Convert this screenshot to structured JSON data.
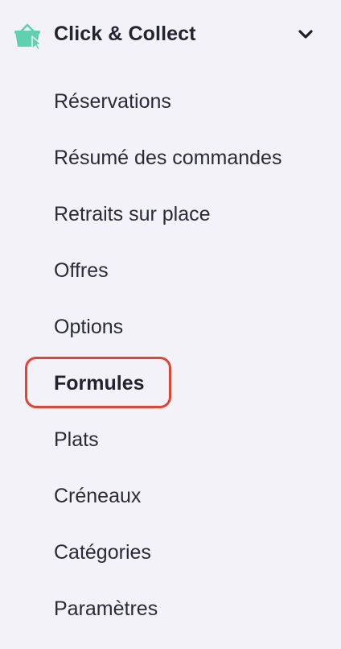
{
  "section": {
    "title": "Click & Collect",
    "icon": "shopping-basket-cursor-icon",
    "icon_color": "#5fd0b0",
    "expand_icon": "chevron-down-icon",
    "expanded": true
  },
  "menu": {
    "items": [
      {
        "label": "Réservations",
        "active": false
      },
      {
        "label": "Résumé des commandes",
        "active": false
      },
      {
        "label": "Retraits sur place",
        "active": false
      },
      {
        "label": "Offres",
        "active": false
      },
      {
        "label": "Options",
        "active": false
      },
      {
        "label": "Formules",
        "active": true
      },
      {
        "label": "Plats",
        "active": false
      },
      {
        "label": "Créneaux",
        "active": false
      },
      {
        "label": "Catégories",
        "active": false
      },
      {
        "label": "Paramètres",
        "active": false
      }
    ]
  },
  "highlight": {
    "target": "Formules",
    "color": "#e5432f"
  }
}
